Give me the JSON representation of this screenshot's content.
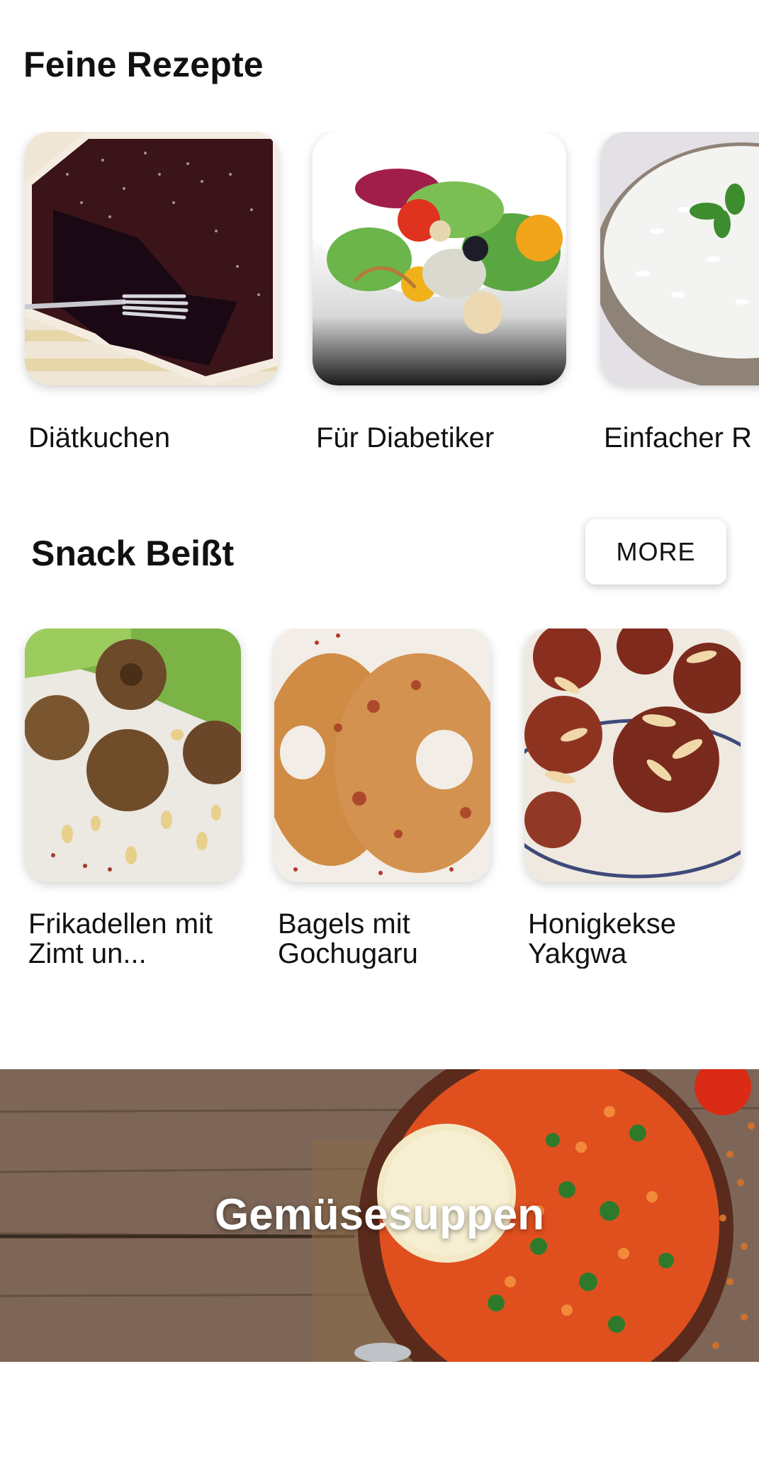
{
  "section1": {
    "title": "Feine Rezepte",
    "cards": [
      {
        "label": "Diätkuchen",
        "image": "chocolate-cake-image"
      },
      {
        "label": "Für Diabetiker",
        "image": "salad-image"
      },
      {
        "label": "Einfacher R",
        "image": "rice-bowl-image"
      }
    ]
  },
  "section2": {
    "title": "Snack Beißt",
    "more_label": "MORE",
    "cards": [
      {
        "label": "Frikadellen mit Zimt un...",
        "image": "meatballs-image"
      },
      {
        "label": "Bagels mit Gochugaru",
        "image": "bagels-image"
      },
      {
        "label": "Honigkekse Yakgwa",
        "image": "honey-cookies-image"
      }
    ]
  },
  "banner": {
    "title": "Gemüsesuppen",
    "image": "lentil-soup-image"
  }
}
